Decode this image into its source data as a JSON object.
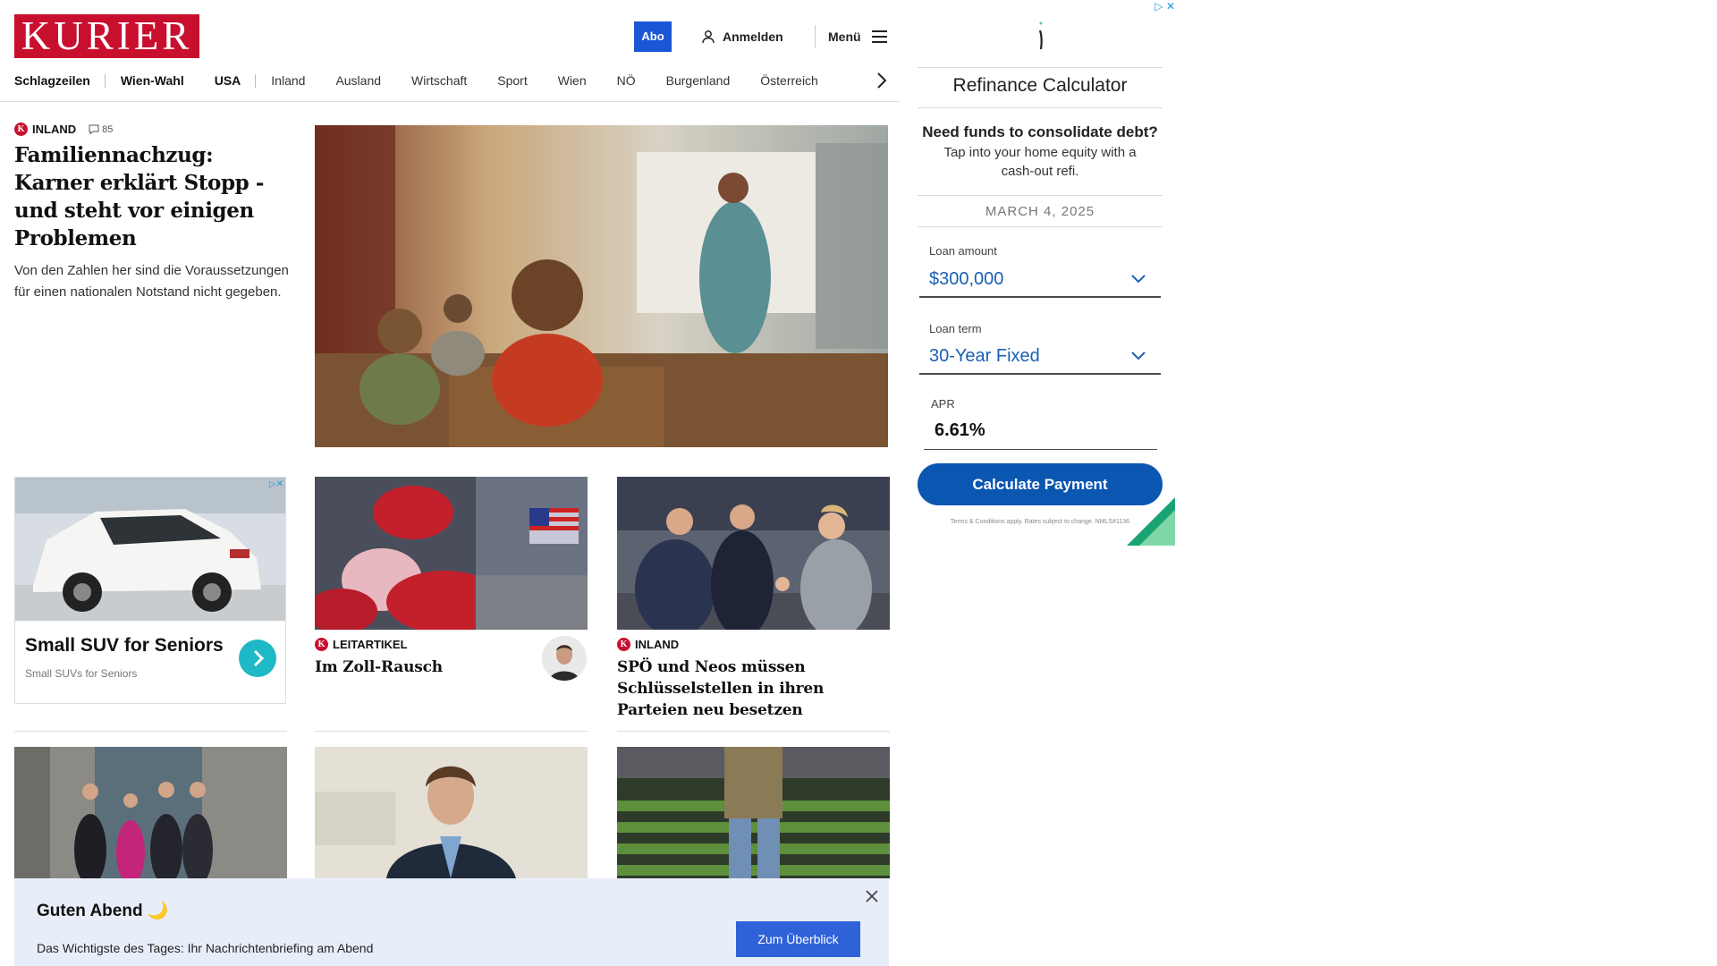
{
  "header": {
    "logo": "KURIER",
    "abo": "Abo",
    "login": "Anmelden",
    "menu": "Menü"
  },
  "nav": {
    "items": [
      "Schlagzeilen",
      "Wien-Wahl",
      "USA",
      "Inland",
      "Ausland",
      "Wirtschaft",
      "Sport",
      "Wien",
      "NÖ",
      "Burgenland",
      "Österreich"
    ]
  },
  "lead": {
    "section": "INLAND",
    "comments": "85",
    "title": "Familiennachzug: Karner erklärt Stopp - und steht vor einigen Problemen",
    "teaser": "Von den Zahlen her sind die Voraussetzungen für einen nationalen Notstand nicht gegeben."
  },
  "ad_suv": {
    "title": "Small SUV for Seniors",
    "subtitle": "Small SUVs for Seniors"
  },
  "cards": [
    {
      "section": "LEITARTIKEL",
      "title": "Im Zoll-Rausch"
    },
    {
      "section": "INLAND",
      "title": "SPÖ und Neos müssen Schlüsselstellen in ihren Parteien neu besetzen"
    }
  ],
  "banner": {
    "title": "Guten Abend 🌙",
    "text": "Das Wichtigste des Tages: Ihr Nachrichtenbriefing am Abend",
    "cta": "Zum Überblick"
  },
  "refi_ad": {
    "title": "Refinance Calculator",
    "headline": "Need funds to consolidate debt?",
    "body": "Tap into your home equity with a cash-out refi.",
    "date": "MARCH 4, 2025",
    "loan_amount_label": "Loan amount",
    "loan_amount_value": "$300,000",
    "loan_term_label": "Loan term",
    "loan_term_value": "30-Year Fixed",
    "apr_label": "APR",
    "apr_value": "6.61%",
    "button": "Calculate Payment",
    "terms": "Terms & Conditions apply. Rates subject to change. NMLS#1136"
  },
  "colors": {
    "brand_red": "#c8102e",
    "abo_blue": "#1a56d6",
    "cta_blue": "#2f62d9",
    "ad_button_blue": "#0a56b1",
    "banner_bg": "#e8eef9",
    "suv_button": "#1eb8c6"
  },
  "icons": [
    "user-icon",
    "hamburger-icon",
    "chevron-right-icon",
    "comment-icon",
    "close-icon",
    "chevron-down-icon",
    "adchoices-icon"
  ]
}
